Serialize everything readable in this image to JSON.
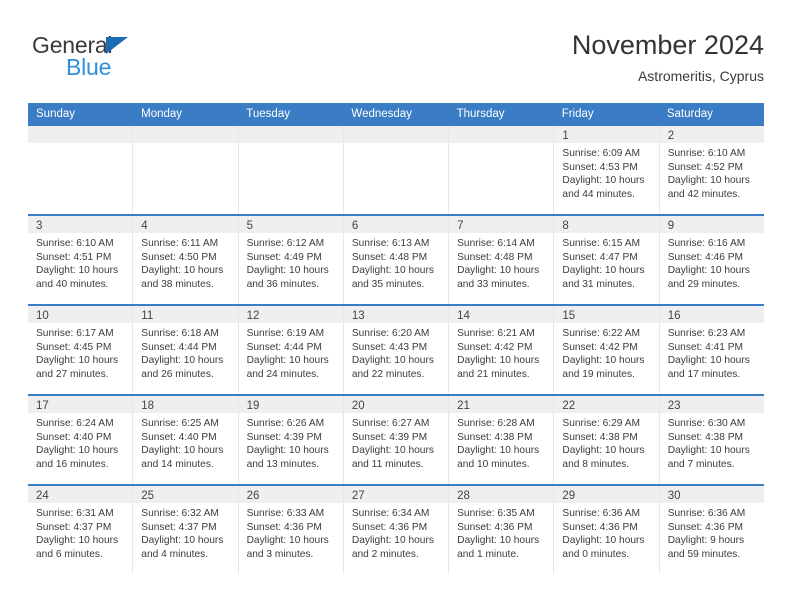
{
  "brand": {
    "word_general": "General",
    "word_blue": "Blue",
    "triangle_color": "#1b6cb5",
    "blue_text_color": "#2f8fdb"
  },
  "header": {
    "title": "November 2024",
    "subtitle": "Astromeritis, Cyprus",
    "header_bg_color": "#3b7dc4",
    "daynum_band_color": "#efefef"
  },
  "weekdays": [
    "Sunday",
    "Monday",
    "Tuesday",
    "Wednesday",
    "Thursday",
    "Friday",
    "Saturday"
  ],
  "weeks": [
    [
      {
        "day": "",
        "lines": []
      },
      {
        "day": "",
        "lines": []
      },
      {
        "day": "",
        "lines": []
      },
      {
        "day": "",
        "lines": []
      },
      {
        "day": "",
        "lines": []
      },
      {
        "day": "1",
        "lines": [
          "Sunrise: 6:09 AM",
          "Sunset: 4:53 PM",
          "Daylight: 10 hours",
          "and 44 minutes."
        ]
      },
      {
        "day": "2",
        "lines": [
          "Sunrise: 6:10 AM",
          "Sunset: 4:52 PM",
          "Daylight: 10 hours",
          "and 42 minutes."
        ]
      }
    ],
    [
      {
        "day": "3",
        "lines": [
          "Sunrise: 6:10 AM",
          "Sunset: 4:51 PM",
          "Daylight: 10 hours",
          "and 40 minutes."
        ]
      },
      {
        "day": "4",
        "lines": [
          "Sunrise: 6:11 AM",
          "Sunset: 4:50 PM",
          "Daylight: 10 hours",
          "and 38 minutes."
        ]
      },
      {
        "day": "5",
        "lines": [
          "Sunrise: 6:12 AM",
          "Sunset: 4:49 PM",
          "Daylight: 10 hours",
          "and 36 minutes."
        ]
      },
      {
        "day": "6",
        "lines": [
          "Sunrise: 6:13 AM",
          "Sunset: 4:48 PM",
          "Daylight: 10 hours",
          "and 35 minutes."
        ]
      },
      {
        "day": "7",
        "lines": [
          "Sunrise: 6:14 AM",
          "Sunset: 4:48 PM",
          "Daylight: 10 hours",
          "and 33 minutes."
        ]
      },
      {
        "day": "8",
        "lines": [
          "Sunrise: 6:15 AM",
          "Sunset: 4:47 PM",
          "Daylight: 10 hours",
          "and 31 minutes."
        ]
      },
      {
        "day": "9",
        "lines": [
          "Sunrise: 6:16 AM",
          "Sunset: 4:46 PM",
          "Daylight: 10 hours",
          "and 29 minutes."
        ]
      }
    ],
    [
      {
        "day": "10",
        "lines": [
          "Sunrise: 6:17 AM",
          "Sunset: 4:45 PM",
          "Daylight: 10 hours",
          "and 27 minutes."
        ]
      },
      {
        "day": "11",
        "lines": [
          "Sunrise: 6:18 AM",
          "Sunset: 4:44 PM",
          "Daylight: 10 hours",
          "and 26 minutes."
        ]
      },
      {
        "day": "12",
        "lines": [
          "Sunrise: 6:19 AM",
          "Sunset: 4:44 PM",
          "Daylight: 10 hours",
          "and 24 minutes."
        ]
      },
      {
        "day": "13",
        "lines": [
          "Sunrise: 6:20 AM",
          "Sunset: 4:43 PM",
          "Daylight: 10 hours",
          "and 22 minutes."
        ]
      },
      {
        "day": "14",
        "lines": [
          "Sunrise: 6:21 AM",
          "Sunset: 4:42 PM",
          "Daylight: 10 hours",
          "and 21 minutes."
        ]
      },
      {
        "day": "15",
        "lines": [
          "Sunrise: 6:22 AM",
          "Sunset: 4:42 PM",
          "Daylight: 10 hours",
          "and 19 minutes."
        ]
      },
      {
        "day": "16",
        "lines": [
          "Sunrise: 6:23 AM",
          "Sunset: 4:41 PM",
          "Daylight: 10 hours",
          "and 17 minutes."
        ]
      }
    ],
    [
      {
        "day": "17",
        "lines": [
          "Sunrise: 6:24 AM",
          "Sunset: 4:40 PM",
          "Daylight: 10 hours",
          "and 16 minutes."
        ]
      },
      {
        "day": "18",
        "lines": [
          "Sunrise: 6:25 AM",
          "Sunset: 4:40 PM",
          "Daylight: 10 hours",
          "and 14 minutes."
        ]
      },
      {
        "day": "19",
        "lines": [
          "Sunrise: 6:26 AM",
          "Sunset: 4:39 PM",
          "Daylight: 10 hours",
          "and 13 minutes."
        ]
      },
      {
        "day": "20",
        "lines": [
          "Sunrise: 6:27 AM",
          "Sunset: 4:39 PM",
          "Daylight: 10 hours",
          "and 11 minutes."
        ]
      },
      {
        "day": "21",
        "lines": [
          "Sunrise: 6:28 AM",
          "Sunset: 4:38 PM",
          "Daylight: 10 hours",
          "and 10 minutes."
        ]
      },
      {
        "day": "22",
        "lines": [
          "Sunrise: 6:29 AM",
          "Sunset: 4:38 PM",
          "Daylight: 10 hours",
          "and 8 minutes."
        ]
      },
      {
        "day": "23",
        "lines": [
          "Sunrise: 6:30 AM",
          "Sunset: 4:38 PM",
          "Daylight: 10 hours",
          "and 7 minutes."
        ]
      }
    ],
    [
      {
        "day": "24",
        "lines": [
          "Sunrise: 6:31 AM",
          "Sunset: 4:37 PM",
          "Daylight: 10 hours",
          "and 6 minutes."
        ]
      },
      {
        "day": "25",
        "lines": [
          "Sunrise: 6:32 AM",
          "Sunset: 4:37 PM",
          "Daylight: 10 hours",
          "and 4 minutes."
        ]
      },
      {
        "day": "26",
        "lines": [
          "Sunrise: 6:33 AM",
          "Sunset: 4:36 PM",
          "Daylight: 10 hours",
          "and 3 minutes."
        ]
      },
      {
        "day": "27",
        "lines": [
          "Sunrise: 6:34 AM",
          "Sunset: 4:36 PM",
          "Daylight: 10 hours",
          "and 2 minutes."
        ]
      },
      {
        "day": "28",
        "lines": [
          "Sunrise: 6:35 AM",
          "Sunset: 4:36 PM",
          "Daylight: 10 hours",
          "and 1 minute."
        ]
      },
      {
        "day": "29",
        "lines": [
          "Sunrise: 6:36 AM",
          "Sunset: 4:36 PM",
          "Daylight: 10 hours",
          "and 0 minutes."
        ]
      },
      {
        "day": "30",
        "lines": [
          "Sunrise: 6:36 AM",
          "Sunset: 4:36 PM",
          "Daylight: 9 hours",
          "and 59 minutes."
        ]
      }
    ]
  ]
}
